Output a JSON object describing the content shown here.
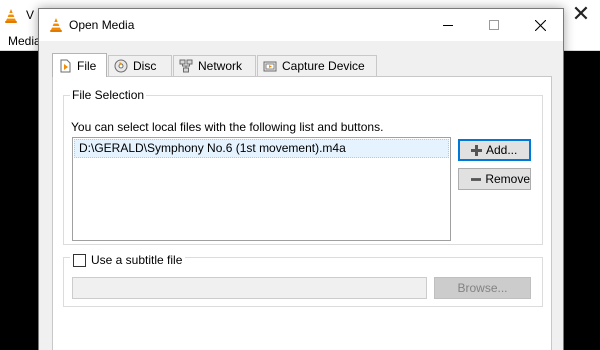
{
  "background_window": {
    "title_fragment": "V",
    "menu_fragment": "Media",
    "close_glyph": "✕"
  },
  "dialog": {
    "title": "Open Media",
    "controls": {
      "minimize": "minimize-icon",
      "maximize": "maximize-icon",
      "close": "close-icon"
    }
  },
  "tabs": [
    {
      "label": "File",
      "icon": "file-icon",
      "active": true
    },
    {
      "label": "Disc",
      "icon": "disc-icon",
      "active": false
    },
    {
      "label": "Network",
      "icon": "network-icon",
      "active": false
    },
    {
      "label": "Capture Device",
      "icon": "capture-device-icon",
      "active": false
    }
  ],
  "file_selection": {
    "group_title": "File Selection",
    "description": "You can select local files with the following list and buttons.",
    "files": [
      "D:\\GERALD\\Symphony No.6 (1st movement).m4a"
    ],
    "add_label": "Add...",
    "remove_label": "Remove"
  },
  "subtitle": {
    "checkbox_label": "Use a subtitle file",
    "checked": false,
    "path_value": "",
    "browse_label": "Browse..."
  },
  "colors": {
    "accent": "#0078d7",
    "vlc_orange": "#f48b00",
    "selection": "#e5f3ff"
  }
}
